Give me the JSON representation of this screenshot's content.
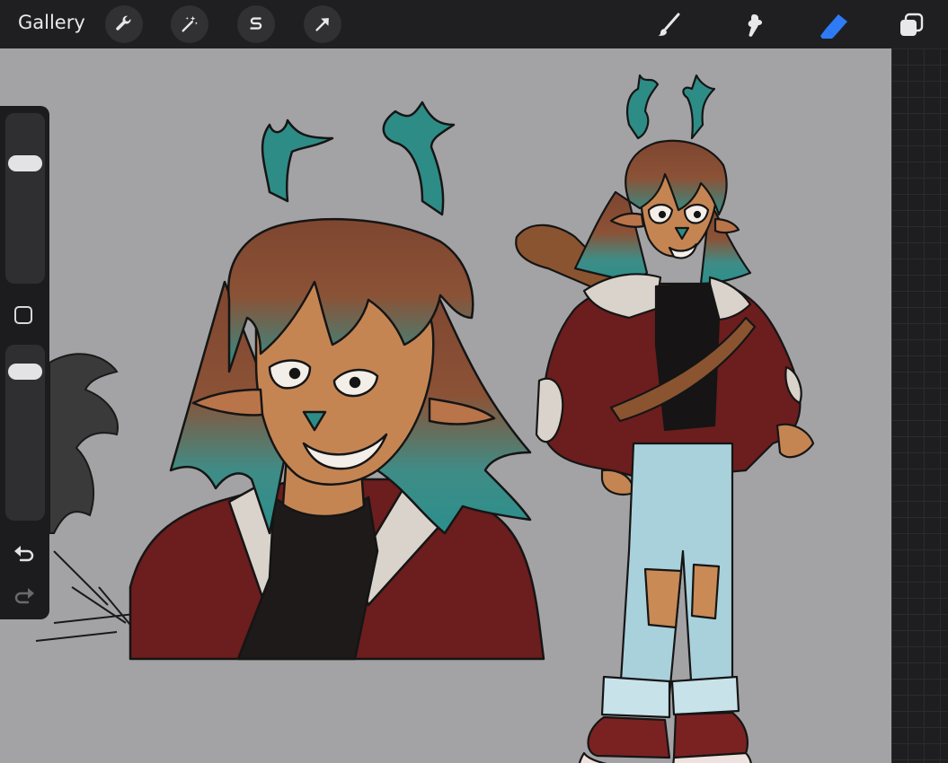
{
  "toolbar": {
    "gallery_label": "Gallery",
    "left_tools": [
      {
        "name": "actions-wrench-icon"
      },
      {
        "name": "adjustments-magic-wand-icon"
      },
      {
        "name": "selection-s-icon"
      },
      {
        "name": "transform-arrow-icon"
      }
    ],
    "right_tools": [
      {
        "name": "brush-icon",
        "active": false
      },
      {
        "name": "smudge-icon",
        "active": false
      },
      {
        "name": "eraser-icon",
        "active": true
      },
      {
        "name": "layers-icon",
        "active": false
      }
    ]
  },
  "sidebar": {
    "brush_size_level": 0.25,
    "opacity_level": 0.08,
    "modify_button": "square-modify-icon",
    "undo_icon": "undo-arrow-icon",
    "redo_icon": "redo-arrow-icon"
  },
  "colors": {
    "canvas_bg": "#a3a3a5",
    "eraser_active": "#2f7bf6",
    "jacket_red": "#6e1e1e",
    "hair_brown": "#8a4e32",
    "hair_teal": "#2e8a86",
    "skin": "#c98a55",
    "jeans": "#a9d1dc"
  },
  "artwork": {
    "subjects": [
      "character-bust-sketch",
      "character-full-body-sketch",
      "partial-dark-sketch"
    ]
  }
}
